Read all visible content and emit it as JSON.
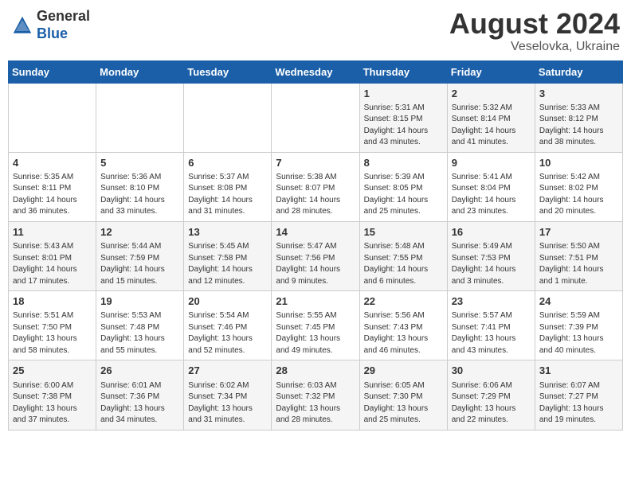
{
  "header": {
    "logo_general": "General",
    "logo_blue": "Blue",
    "month_year": "August 2024",
    "location": "Veselovka, Ukraine"
  },
  "weekdays": [
    "Sunday",
    "Monday",
    "Tuesday",
    "Wednesday",
    "Thursday",
    "Friday",
    "Saturday"
  ],
  "weeks": [
    [
      {
        "day": "",
        "info": ""
      },
      {
        "day": "",
        "info": ""
      },
      {
        "day": "",
        "info": ""
      },
      {
        "day": "",
        "info": ""
      },
      {
        "day": "1",
        "info": "Sunrise: 5:31 AM\nSunset: 8:15 PM\nDaylight: 14 hours\nand 43 minutes."
      },
      {
        "day": "2",
        "info": "Sunrise: 5:32 AM\nSunset: 8:14 PM\nDaylight: 14 hours\nand 41 minutes."
      },
      {
        "day": "3",
        "info": "Sunrise: 5:33 AM\nSunset: 8:12 PM\nDaylight: 14 hours\nand 38 minutes."
      }
    ],
    [
      {
        "day": "4",
        "info": "Sunrise: 5:35 AM\nSunset: 8:11 PM\nDaylight: 14 hours\nand 36 minutes."
      },
      {
        "day": "5",
        "info": "Sunrise: 5:36 AM\nSunset: 8:10 PM\nDaylight: 14 hours\nand 33 minutes."
      },
      {
        "day": "6",
        "info": "Sunrise: 5:37 AM\nSunset: 8:08 PM\nDaylight: 14 hours\nand 31 minutes."
      },
      {
        "day": "7",
        "info": "Sunrise: 5:38 AM\nSunset: 8:07 PM\nDaylight: 14 hours\nand 28 minutes."
      },
      {
        "day": "8",
        "info": "Sunrise: 5:39 AM\nSunset: 8:05 PM\nDaylight: 14 hours\nand 25 minutes."
      },
      {
        "day": "9",
        "info": "Sunrise: 5:41 AM\nSunset: 8:04 PM\nDaylight: 14 hours\nand 23 minutes."
      },
      {
        "day": "10",
        "info": "Sunrise: 5:42 AM\nSunset: 8:02 PM\nDaylight: 14 hours\nand 20 minutes."
      }
    ],
    [
      {
        "day": "11",
        "info": "Sunrise: 5:43 AM\nSunset: 8:01 PM\nDaylight: 14 hours\nand 17 minutes."
      },
      {
        "day": "12",
        "info": "Sunrise: 5:44 AM\nSunset: 7:59 PM\nDaylight: 14 hours\nand 15 minutes."
      },
      {
        "day": "13",
        "info": "Sunrise: 5:45 AM\nSunset: 7:58 PM\nDaylight: 14 hours\nand 12 minutes."
      },
      {
        "day": "14",
        "info": "Sunrise: 5:47 AM\nSunset: 7:56 PM\nDaylight: 14 hours\nand 9 minutes."
      },
      {
        "day": "15",
        "info": "Sunrise: 5:48 AM\nSunset: 7:55 PM\nDaylight: 14 hours\nand 6 minutes."
      },
      {
        "day": "16",
        "info": "Sunrise: 5:49 AM\nSunset: 7:53 PM\nDaylight: 14 hours\nand 3 minutes."
      },
      {
        "day": "17",
        "info": "Sunrise: 5:50 AM\nSunset: 7:51 PM\nDaylight: 14 hours\nand 1 minute."
      }
    ],
    [
      {
        "day": "18",
        "info": "Sunrise: 5:51 AM\nSunset: 7:50 PM\nDaylight: 13 hours\nand 58 minutes."
      },
      {
        "day": "19",
        "info": "Sunrise: 5:53 AM\nSunset: 7:48 PM\nDaylight: 13 hours\nand 55 minutes."
      },
      {
        "day": "20",
        "info": "Sunrise: 5:54 AM\nSunset: 7:46 PM\nDaylight: 13 hours\nand 52 minutes."
      },
      {
        "day": "21",
        "info": "Sunrise: 5:55 AM\nSunset: 7:45 PM\nDaylight: 13 hours\nand 49 minutes."
      },
      {
        "day": "22",
        "info": "Sunrise: 5:56 AM\nSunset: 7:43 PM\nDaylight: 13 hours\nand 46 minutes."
      },
      {
        "day": "23",
        "info": "Sunrise: 5:57 AM\nSunset: 7:41 PM\nDaylight: 13 hours\nand 43 minutes."
      },
      {
        "day": "24",
        "info": "Sunrise: 5:59 AM\nSunset: 7:39 PM\nDaylight: 13 hours\nand 40 minutes."
      }
    ],
    [
      {
        "day": "25",
        "info": "Sunrise: 6:00 AM\nSunset: 7:38 PM\nDaylight: 13 hours\nand 37 minutes."
      },
      {
        "day": "26",
        "info": "Sunrise: 6:01 AM\nSunset: 7:36 PM\nDaylight: 13 hours\nand 34 minutes."
      },
      {
        "day": "27",
        "info": "Sunrise: 6:02 AM\nSunset: 7:34 PM\nDaylight: 13 hours\nand 31 minutes."
      },
      {
        "day": "28",
        "info": "Sunrise: 6:03 AM\nSunset: 7:32 PM\nDaylight: 13 hours\nand 28 minutes."
      },
      {
        "day": "29",
        "info": "Sunrise: 6:05 AM\nSunset: 7:30 PM\nDaylight: 13 hours\nand 25 minutes."
      },
      {
        "day": "30",
        "info": "Sunrise: 6:06 AM\nSunset: 7:29 PM\nDaylight: 13 hours\nand 22 minutes."
      },
      {
        "day": "31",
        "info": "Sunrise: 6:07 AM\nSunset: 7:27 PM\nDaylight: 13 hours\nand 19 minutes."
      }
    ]
  ]
}
